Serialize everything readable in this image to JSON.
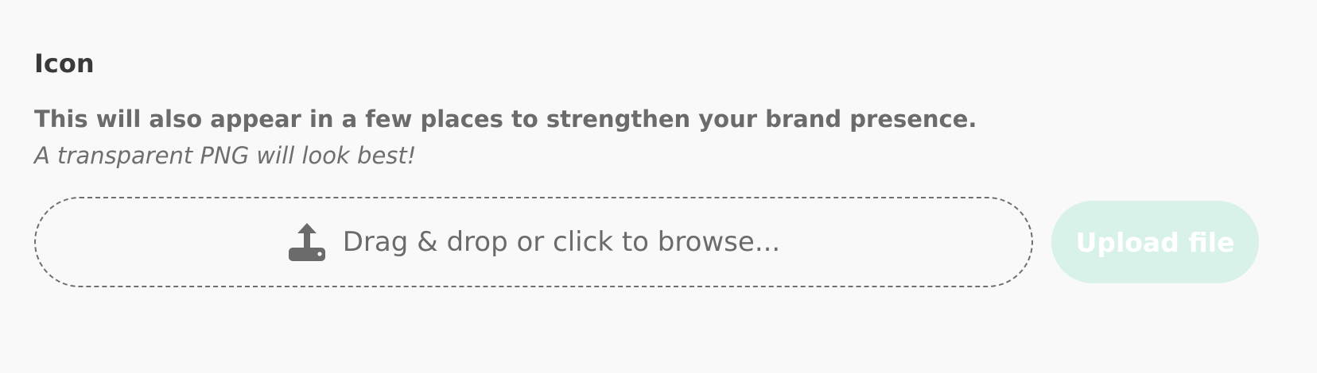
{
  "section": {
    "title": "Icon",
    "description": "This will also appear in a few places to strengthen your brand presence.",
    "hint": "A transparent PNG will look best!"
  },
  "dropzone": {
    "label": "Drag & drop or click to browse...",
    "icon": "upload-tray-icon"
  },
  "upload_button": {
    "label": "Upload file",
    "state": "disabled"
  },
  "colors": {
    "upload_button_bg": "#d8f2ea",
    "upload_button_text": "#ffffff",
    "text_dark": "#3a3a3a",
    "text_muted": "#6b6b6b",
    "dropzone_border": "#6f6f6f"
  }
}
